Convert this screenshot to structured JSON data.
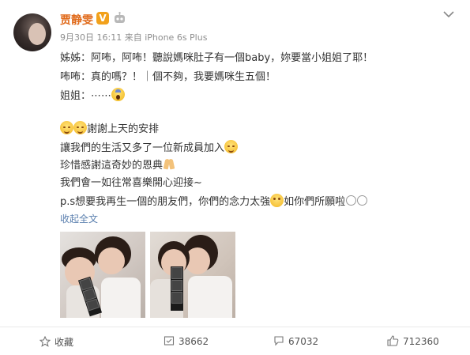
{
  "post": {
    "username": "贾静雯",
    "verified_badge": "V",
    "timestamp": "9月30日 16:11",
    "source": "来自 iPhone 6s Plus",
    "lines": [
      "姊姊：阿咘，阿咘！聽說媽咪肚子有一個baby，妳要當小姐姐了耶！",
      "咘咘：真的嗎？！｜個不夠，我要媽咪生五個！",
      "姐姐：⋯⋯",
      "謝謝上天的安排",
      "讓我們的生活又多了一位新成員加入",
      "珍惜感謝這奇妙的恩典",
      "我們會一如往常喜樂開心迎接~",
      "p.s想要我再生一個的朋友們，你們的念力太強",
      "如你們所願啦"
    ],
    "collapse_label": "收起全文"
  },
  "photos": [
    {
      "name": "photo-sisters-hug"
    },
    {
      "name": "photo-sisters-kiss"
    }
  ],
  "actions": {
    "favorite": "收藏",
    "repost": "38662",
    "comment": "67032",
    "like": "712360"
  },
  "colors": {
    "username": "#e06a1a",
    "badge": "#f2a11b",
    "link": "#5a7fae",
    "meta": "#8e8e8e"
  },
  "icons": [
    "chevron-down-icon",
    "robot-icon",
    "star-icon",
    "repost-icon",
    "comment-icon",
    "thumbs-up-icon"
  ]
}
